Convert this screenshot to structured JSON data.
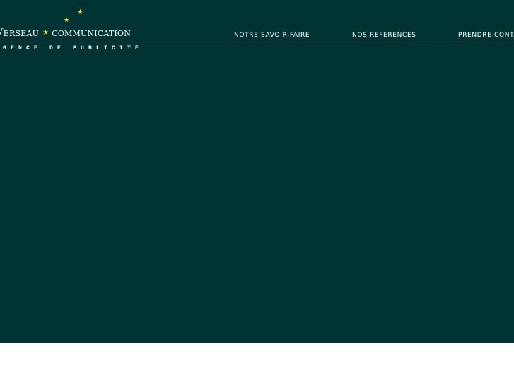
{
  "brand": {
    "name_start": "Verseau",
    "separator_star": "★",
    "name_end": "communication",
    "tagline": "AGENCE DE PUBLICITÉ",
    "decorative_stars": [
      "★",
      "★"
    ]
  },
  "navigation": {
    "items": [
      {
        "label": "NOTRE SAVOIR-FAIRE"
      },
      {
        "label": "NOS REFERENCES"
      },
      {
        "label": "PRENDRE CONTACT"
      }
    ]
  },
  "colors": {
    "hero_background": "#003434",
    "page_background": "#ffffff",
    "accent_star": "#ffd11a",
    "text": "#ffffff"
  },
  "icons": {
    "brand_star": "star-icon"
  }
}
